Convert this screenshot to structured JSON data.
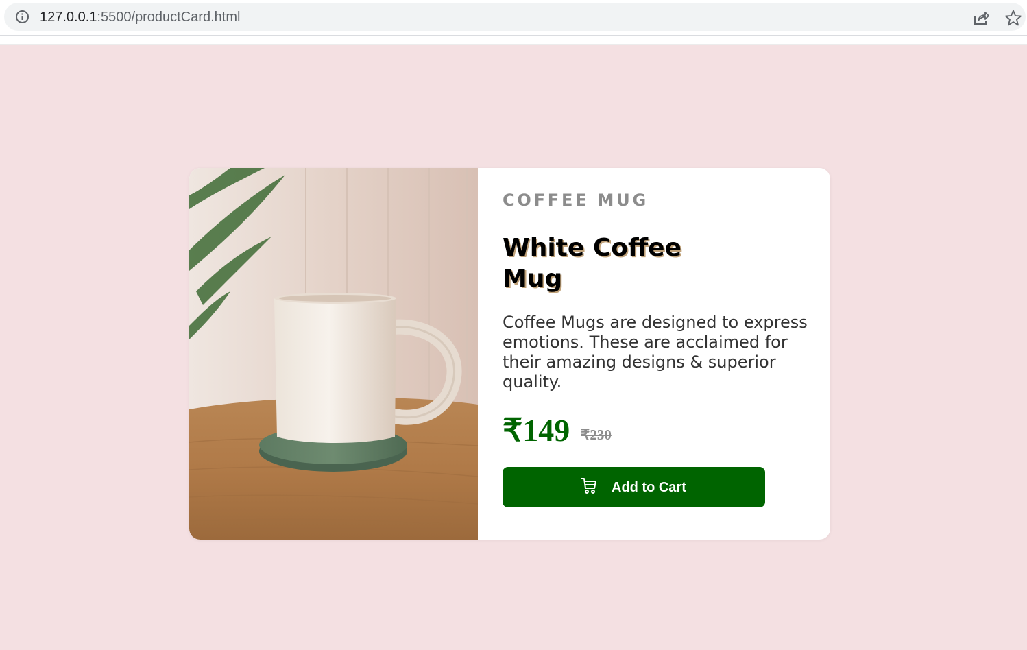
{
  "browser": {
    "url_host": "127.0.0.1",
    "url_rest": ":5500/productCard.html",
    "icons": {
      "info": "info-icon",
      "share": "share-icon",
      "bookmark": "star-icon"
    }
  },
  "product": {
    "category": "COFFEE MUG",
    "title": "White Coffee Mug",
    "description": "Coffee Mugs are designed to express emotions. These are acclaimed for their amazing designs & superior quality.",
    "price": "₹149",
    "old_price": "₹230",
    "button_label": "Add to Cart",
    "button_icon": "cart-icon",
    "image": "white-coffee-mug-photo"
  },
  "colors": {
    "page_background": "#f4e0e2",
    "card_background": "#ffffff",
    "accent_green": "#006400",
    "muted_gray": "#8c8c8c"
  }
}
